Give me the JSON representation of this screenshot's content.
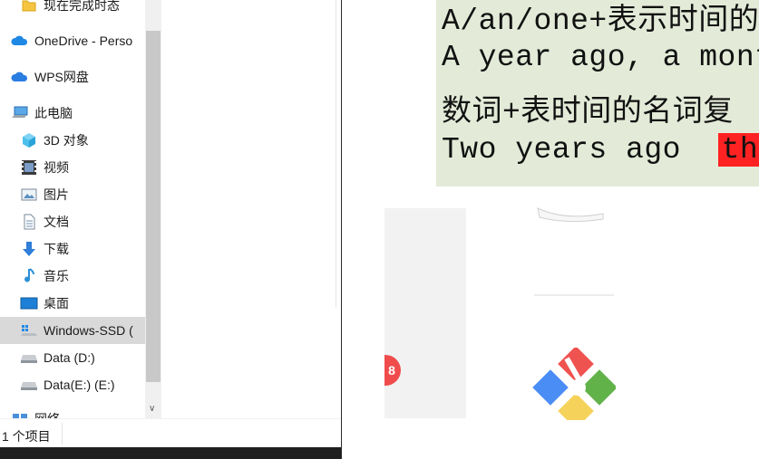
{
  "explorer": {
    "nav_items": [
      {
        "label": "现在完成时态",
        "icon": "folder-icon"
      },
      {
        "label": "OneDrive - Perso",
        "icon": "onedrive-icon"
      },
      {
        "label": "WPS网盘",
        "icon": "wps-cloud-icon"
      },
      {
        "label": "此电脑",
        "icon": "computer-icon"
      },
      {
        "label": "3D 对象",
        "icon": "3d-objects-icon"
      },
      {
        "label": "视频",
        "icon": "video-icon"
      },
      {
        "label": "图片",
        "icon": "pictures-icon"
      },
      {
        "label": "文档",
        "icon": "documents-icon"
      },
      {
        "label": "下载",
        "icon": "download-icon"
      },
      {
        "label": "音乐",
        "icon": "music-icon"
      },
      {
        "label": "桌面",
        "icon": "desktop-icon"
      },
      {
        "label": "Windows-SSD (",
        "icon": "windows-drive-icon",
        "selected": true
      },
      {
        "label": "Data (D:)",
        "icon": "drive-icon"
      },
      {
        "label": "Data(E:) (E:)",
        "icon": "drive-icon"
      },
      {
        "label": "网络",
        "icon": "network-icon"
      }
    ],
    "status": "1 个项目"
  },
  "document": {
    "slide_lines": [
      "A/an/one+表示时间的",
      "A year ago, a mont",
      "数词+表时间的名词复",
      "Two years ago"
    ],
    "slide_highlight": "thr",
    "badge_text": "8"
  },
  "colors": {
    "slide_bg": "#e3ebd8",
    "highlight": "#ff2222",
    "selected_row": "#d9d9d9",
    "badge": "#f04c4c"
  }
}
